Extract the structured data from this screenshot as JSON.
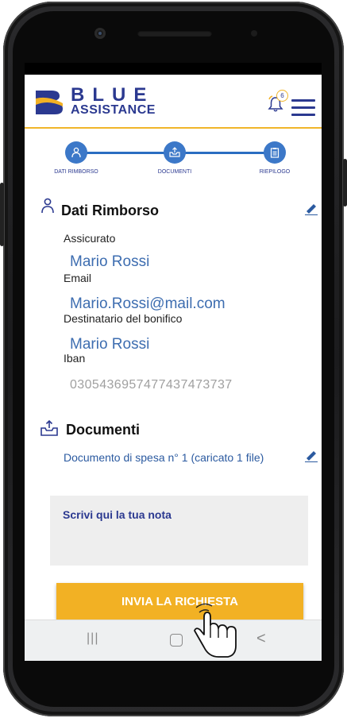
{
  "header": {
    "logo_top": "BLUE",
    "logo_bottom": "ASSISTANCE",
    "notification_count": "6"
  },
  "stepper": {
    "steps": [
      {
        "label": "DATI RIMBORSO",
        "icon": "user-icon"
      },
      {
        "label": "DOCUMENTI",
        "icon": "upload-tray-icon"
      },
      {
        "label": "RIEPILOGO",
        "icon": "clipboard-icon"
      }
    ]
  },
  "dati_rimborso": {
    "title": "Dati Rimborso",
    "fields": [
      {
        "label": "Assicurato",
        "value": "Mario Rossi"
      },
      {
        "label": "Email",
        "value": "Mario.Rossi@mail.com"
      },
      {
        "label": "Destinatario del bonifico",
        "value": "Mario Rossi"
      },
      {
        "label": "Iban",
        "value": "030543695747743747373​7"
      }
    ]
  },
  "documenti": {
    "title": "Documenti",
    "item": "Documento di spesa n° 1 (caricato 1 file)"
  },
  "note": {
    "placeholder": "Scrivi qui la tua nota"
  },
  "actions": {
    "submit_label": "INVIA LA RICHIESTA"
  },
  "nav": {
    "recents": "|||",
    "home": "○",
    "back": "<"
  },
  "colors": {
    "brand_blue": "#2b3990",
    "accent_yellow": "#f2b124",
    "step_blue": "#3c78c8"
  }
}
